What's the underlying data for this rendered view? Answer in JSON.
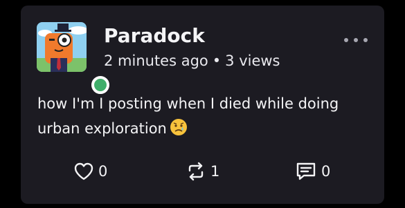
{
  "post": {
    "author": "Paradock",
    "time": "2 minutes ago",
    "separator": "•",
    "views": "3 views",
    "body": "how I'm I posting when I died while doing urban exploration",
    "emoji": "sad-face-emoji"
  },
  "actions": {
    "likes": "0",
    "reposts": "1",
    "comments": "0"
  },
  "colors": {
    "background": "#000000",
    "card": "#1c1b22",
    "text": "#f4f4f6",
    "online": "#3fae6a"
  }
}
